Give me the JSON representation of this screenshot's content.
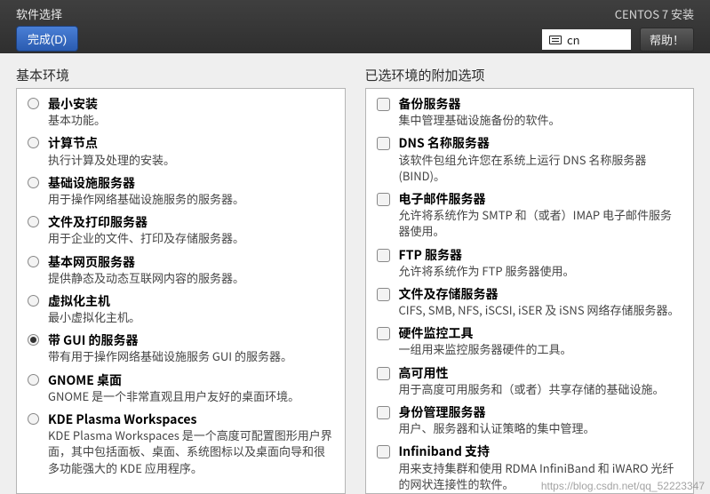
{
  "header": {
    "title": "软件选择",
    "done_label": "完成(D)",
    "install_title": "CENTOS 7 安装",
    "lang": "cn",
    "help_label": "帮助！"
  },
  "left": {
    "title": "基本环境",
    "selected_index": 6,
    "items": [
      {
        "label": "最小安装",
        "desc": "基本功能。"
      },
      {
        "label": "计算节点",
        "desc": "执行计算及处理的安装。"
      },
      {
        "label": "基础设施服务器",
        "desc": "用于操作网络基础设施服务的服务器。"
      },
      {
        "label": "文件及打印服务器",
        "desc": "用于企业的文件、打印及存储服务器。"
      },
      {
        "label": "基本网页服务器",
        "desc": "提供静态及动态互联网内容的服务器。"
      },
      {
        "label": "虚拟化主机",
        "desc": "最小虚拟化主机。"
      },
      {
        "label": "带 GUI 的服务器",
        "desc": "带有用于操作网络基础设施服务 GUI 的服务器。"
      },
      {
        "label": "GNOME 桌面",
        "desc": "GNOME 是一个非常直观且用户友好的桌面环境。"
      },
      {
        "label": "KDE Plasma Workspaces",
        "desc": "KDE Plasma Workspaces 是一个高度可配置图形用户界面，其中包括面板、桌面、系统图标以及桌面向导和很多功能强大的 KDE 应用程序。"
      }
    ]
  },
  "right": {
    "title": "已选环境的附加选项",
    "items": [
      {
        "label": "备份服务器",
        "desc": "集中管理基础设施备份的软件。"
      },
      {
        "label": "DNS 名称服务器",
        "desc": "该软件包组允许您在系统上运行 DNS 名称服务器(BIND)。"
      },
      {
        "label": "电子邮件服务器",
        "desc": "允许将系统作为 SMTP 和（或者）IMAP 电子邮件服务器使用。"
      },
      {
        "label": "FTP 服务器",
        "desc": "允许将系统作为 FTP 服务器使用。"
      },
      {
        "label": "文件及存储服务器",
        "desc": "CIFS, SMB, NFS, iSCSI, iSER 及 iSNS 网络存储服务器。"
      },
      {
        "label": "硬件监控工具",
        "desc": "一组用来监控服务器硬件的工具。"
      },
      {
        "label": "高可用性",
        "desc": "用于高度可用服务和（或者）共享存储的基础设施。"
      },
      {
        "label": "身份管理服务器",
        "desc": "用户、服务器和认证策略的集中管理。"
      },
      {
        "label": "Infiniband 支持",
        "desc": "用来支持集群和使用 RDMA InfiniBand 和 iWARO 光纤的网状连接性的软件。"
      }
    ]
  },
  "watermark": "https://blog.csdn.net/qq_52223347"
}
